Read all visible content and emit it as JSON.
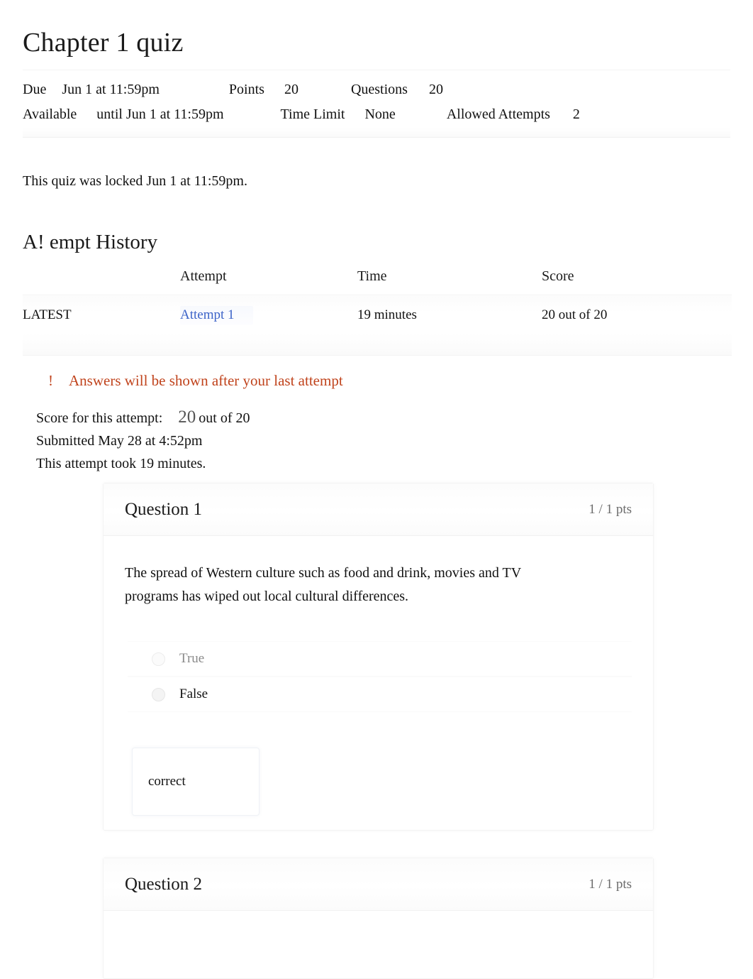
{
  "quiz": {
    "title": "Chapter 1 quiz",
    "details": {
      "due_label": "Due",
      "due_value": "Jun 1 at 11:59pm",
      "points_label": "Points",
      "points_value": "20",
      "questions_label": "Questions",
      "questions_value": "20",
      "available_label": "Available",
      "available_value": "until Jun 1 at 11:59pm",
      "time_limit_label": "Time Limit",
      "time_limit_value": "None",
      "allowed_attempts_label": "Allowed Attempts",
      "allowed_attempts_value": "2"
    },
    "locked_notice": "This quiz was locked Jun 1 at 11:59pm."
  },
  "attempt_history": {
    "heading": "A! empt History",
    "columns": [
      "",
      "Attempt",
      "Time",
      "Score"
    ],
    "rows": [
      {
        "marker": "LATEST",
        "attempt": "Attempt 1",
        "time": "19 minutes",
        "score": "20 out of 20"
      }
    ]
  },
  "answers_note": {
    "icon": "warning-exclamation-icon",
    "text": "Answers will be shown after your last attempt",
    "color": "#c0431c"
  },
  "score_summary": {
    "score_label": "Score for this attempt:",
    "score_value": "20",
    "score_suffix": "out of 20",
    "submitted": "Submitted May 28 at 4:52pm",
    "duration": "This attempt took 19 minutes."
  },
  "questions": [
    {
      "name": "Question 1",
      "points": "1 / 1 pts",
      "text": "The spread of Western culture such as food and drink, movies and TV programs has wiped out local cultural differences.",
      "answers": [
        {
          "label": "True",
          "state": "faded"
        },
        {
          "label": "False",
          "state": "selected"
        }
      ],
      "feedback": "correct"
    },
    {
      "name": "Question 2",
      "points": "1 / 1 pts"
    }
  ],
  "colors": {
    "link": "#3d64c8",
    "warning": "#c0431c",
    "text": "#111111",
    "muted": "#6b6b6b"
  }
}
